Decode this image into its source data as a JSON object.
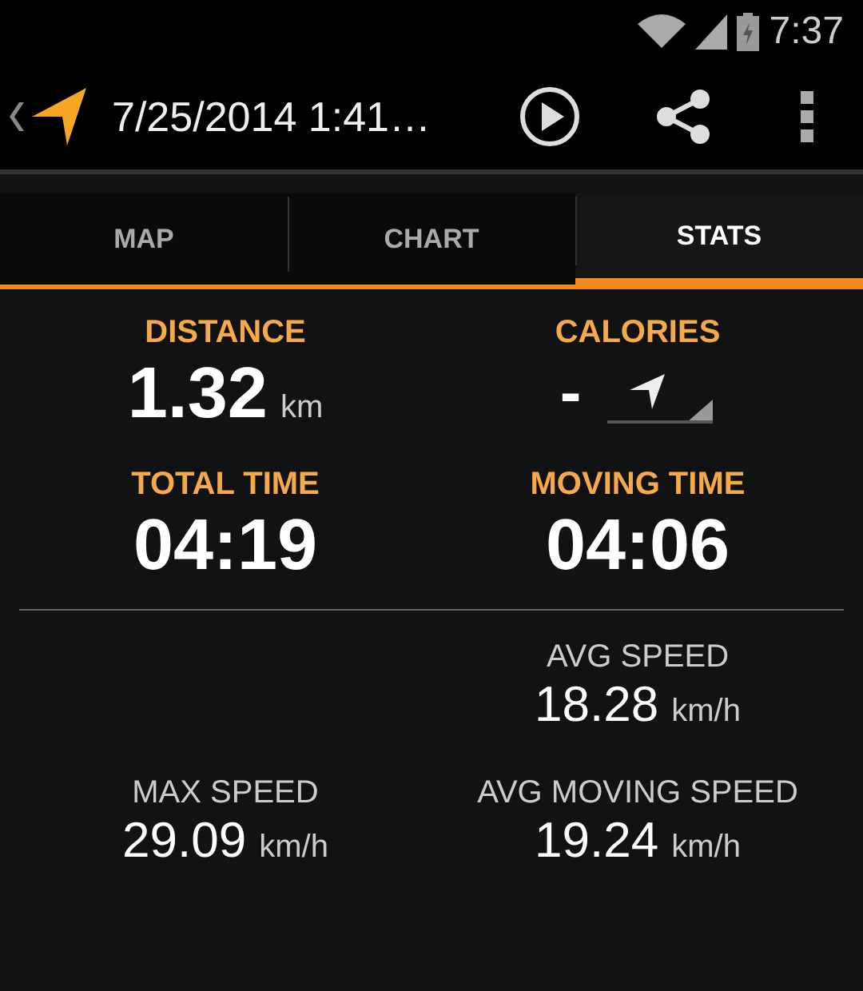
{
  "status_bar": {
    "time": "7:37"
  },
  "action_bar": {
    "title": "7/25/2014 1:41…"
  },
  "tabs": [
    {
      "label": "MAP",
      "selected": false
    },
    {
      "label": "CHART",
      "selected": false
    },
    {
      "label": "STATS",
      "selected": true
    }
  ],
  "main_stats": [
    {
      "kind": "value",
      "label": "DISTANCE",
      "value": "1.32",
      "unit": "km"
    },
    {
      "kind": "selector",
      "label": "CALORIES",
      "value": "-"
    },
    {
      "kind": "value",
      "label": "TOTAL TIME",
      "value": "04:19"
    },
    {
      "kind": "value",
      "label": "MOVING TIME",
      "value": "04:06"
    }
  ],
  "speed_rows": [
    {
      "right": {
        "label": "AVG SPEED",
        "value": "18.28",
        "unit": "km/h"
      }
    },
    {
      "left": {
        "label": "MAX SPEED",
        "value": "29.09",
        "unit": "km/h"
      },
      "right": {
        "label": "AVG MOVING SPEED",
        "value": "19.24",
        "unit": "km/h"
      }
    }
  ]
}
